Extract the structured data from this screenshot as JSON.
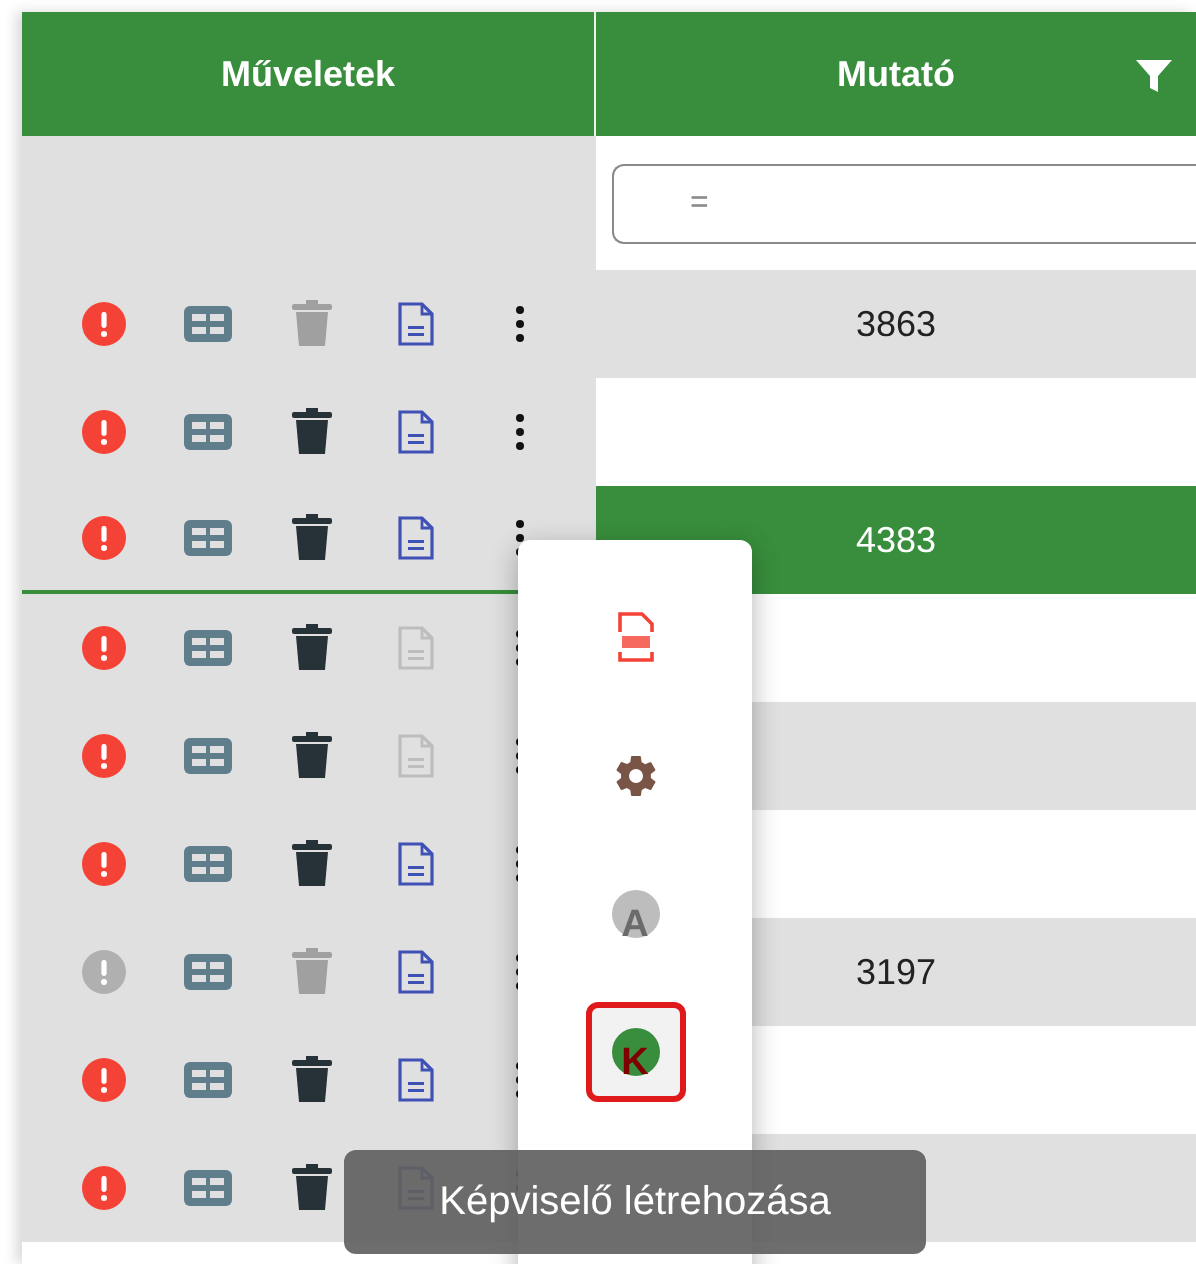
{
  "columns": [
    {
      "label": "Műveletek",
      "filter": false
    },
    {
      "label": "Mutató",
      "filter": true
    }
  ],
  "filter_field": {
    "operator": "="
  },
  "rows": [
    {
      "alert": true,
      "delete": false,
      "document": true,
      "value": "3863",
      "selected": false
    },
    {
      "alert": true,
      "delete": true,
      "document": true,
      "selected": false
    },
    {
      "alert": true,
      "delete": true,
      "document": true,
      "value": "4383",
      "selected": true
    },
    {
      "alert": true,
      "delete": true,
      "document": false,
      "selected": false
    },
    {
      "alert": true,
      "delete": true,
      "document": false,
      "selected": false
    },
    {
      "alert": true,
      "delete": true,
      "document": true,
      "selected": false
    },
    {
      "alert": false,
      "delete": false,
      "document": true,
      "value": "3197",
      "selected": false
    },
    {
      "alert": true,
      "delete": true,
      "document": true,
      "selected": false
    },
    {
      "alert": true,
      "delete": true,
      "document": true,
      "selected": false
    }
  ],
  "menu": {
    "items": [
      {
        "kind": "pdf",
        "selected": false
      },
      {
        "kind": "gear",
        "selected": false
      },
      {
        "kind": "letter",
        "letter": "A",
        "selected": false
      },
      {
        "kind": "letter",
        "letter": "K",
        "selected": true
      }
    ]
  },
  "tooltip": "Képviselő létrehozása"
}
